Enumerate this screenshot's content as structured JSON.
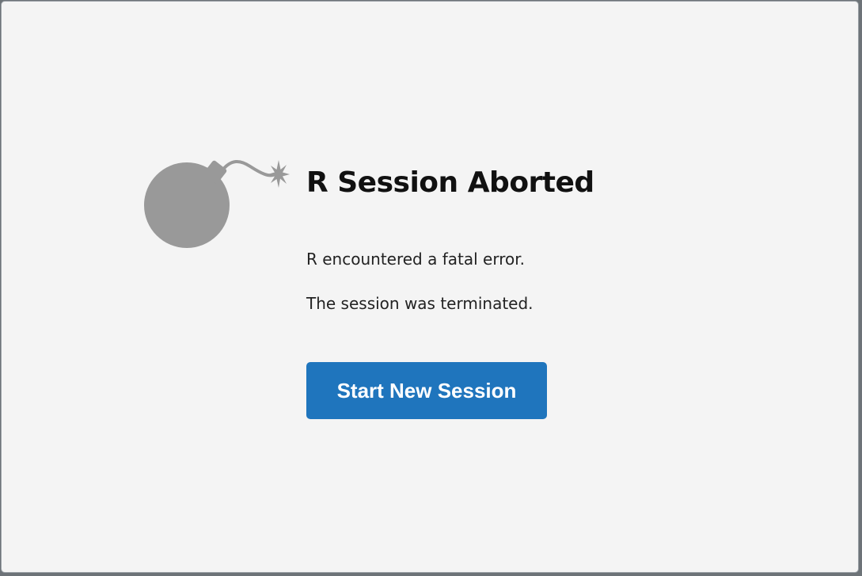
{
  "dialog": {
    "icon": "bomb-icon",
    "title": "R Session Aborted",
    "message_lines": [
      "R encountered a fatal error.",
      "The session was terminated."
    ],
    "button_label": "Start New Session"
  },
  "colors": {
    "background": "#f4f4f4",
    "icon": "#999999",
    "button": "#1f75bd",
    "button_text": "#ffffff",
    "title_text": "#111111"
  }
}
